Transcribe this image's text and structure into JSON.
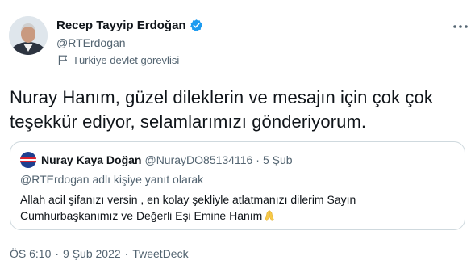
{
  "author": {
    "name": "Recep Tayyip Erdoğan",
    "handle": "@RTErdogan",
    "label": "Türkiye devlet görevlisi",
    "verified_icon": "verified-badge-icon",
    "label_icon": "flag-icon"
  },
  "tweet": {
    "text": "Nuray Hanım, güzel dileklerin ve mesajın için çok çok teşekkür ediyor, selamlarımızı gönderiyorum."
  },
  "quoted": {
    "name": "Nuray Kaya Doğan",
    "handle": "@NurayDO85134116",
    "separator": "·",
    "date": "5 Şub",
    "reply_to": "@RTErdogan adlı kişiye yanıt olarak",
    "text": "Allah acil şifanızı versin , en kolay şekliyle atlatmanızı dilerim Sayın Cumhurbaşkanımız ve Değerli Eşi Emine Hanım",
    "emoji_icon": "folded-hands-icon"
  },
  "meta": {
    "time": "ÖS 6:10",
    "separator": "·",
    "date": "9 Şub 2022",
    "source": "TweetDeck"
  },
  "colors": {
    "text": "#0f1419",
    "secondary": "#536471",
    "border": "#cfd9de",
    "verified": "#1d9bf0"
  }
}
